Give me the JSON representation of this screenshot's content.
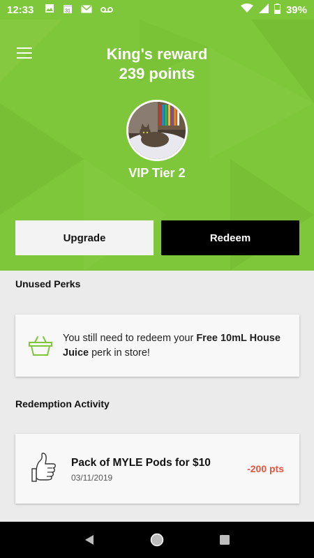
{
  "status_bar": {
    "time": "12:33",
    "battery": "39%",
    "icons": [
      "image-icon",
      "calendar-icon",
      "gmail-icon",
      "voicemail-icon",
      "wifi-icon",
      "signal-icon",
      "battery-icon"
    ]
  },
  "header": {
    "title_line1": "King's reward",
    "title_line2": "239 points",
    "tier": "VIP Tier 2"
  },
  "buttons": {
    "upgrade": "Upgrade",
    "redeem": "Redeem"
  },
  "unused_perks": {
    "title": "Unused Perks",
    "text_before": "You still need to redeem your ",
    "perk_name": "Free 10mL House Juice",
    "text_after": "  perk in store!"
  },
  "redemption_activity": {
    "title": "Redemption Activity",
    "items": [
      {
        "name": "Pack of MYLE Pods for $10",
        "date": "03/11/2019",
        "points": "-200 pts"
      }
    ]
  },
  "colors": {
    "brand_green": "#7ec63a",
    "points_red": "#e8543e"
  }
}
